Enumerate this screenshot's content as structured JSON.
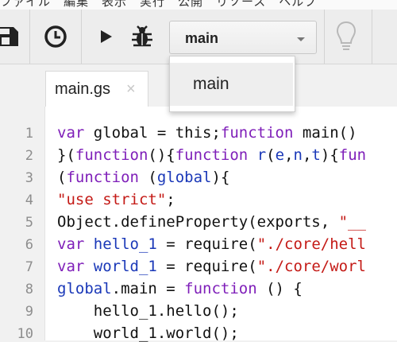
{
  "toolbar": {
    "icons": [
      "save-icon",
      "clock-trigger-icon",
      "run-icon",
      "debug-bug-icon",
      "lightbulb-icon"
    ],
    "function_select": {
      "value": "main"
    }
  },
  "dropdown": {
    "options": [
      "main"
    ]
  },
  "tabs": [
    {
      "label": "main.gs",
      "close": "×"
    }
  ],
  "editor": {
    "line_numbers": [
      "1",
      "2",
      "3",
      "4",
      "5",
      "6",
      "7",
      "8",
      "9",
      "10"
    ],
    "lines": [
      [
        [
          "k",
          "var"
        ],
        [
          "t",
          " global = this;"
        ],
        [
          "k",
          "function"
        ],
        [
          "t",
          " main() "
        ]
      ],
      [
        [
          "t",
          "}("
        ],
        [
          "k",
          "function"
        ],
        [
          "t",
          "(){"
        ],
        [
          "k",
          "function"
        ],
        [
          "t",
          " "
        ],
        [
          "v",
          "r"
        ],
        [
          "t",
          "("
        ],
        [
          "v",
          "e"
        ],
        [
          "t",
          ","
        ],
        [
          "v",
          "n"
        ],
        [
          "t",
          ","
        ],
        [
          "v",
          "t"
        ],
        [
          "t",
          "){"
        ],
        [
          "k",
          "fun"
        ]
      ],
      [
        [
          "t",
          "("
        ],
        [
          "k",
          "function"
        ],
        [
          "t",
          " ("
        ],
        [
          "v",
          "global"
        ],
        [
          "t",
          "){"
        ]
      ],
      [
        [
          "s",
          "\"use strict\""
        ],
        [
          "t",
          ";"
        ]
      ],
      [
        [
          "t",
          "Object.defineProperty(exports, "
        ],
        [
          "s",
          "\"__"
        ]
      ],
      [
        [
          "k",
          "var"
        ],
        [
          "t",
          " "
        ],
        [
          "v",
          "hello_1"
        ],
        [
          "t",
          " = require("
        ],
        [
          "s",
          "\"./core/hell"
        ]
      ],
      [
        [
          "k",
          "var"
        ],
        [
          "t",
          " "
        ],
        [
          "v",
          "world_1"
        ],
        [
          "t",
          " = require("
        ],
        [
          "s",
          "\"./core/worl"
        ]
      ],
      [
        [
          "v",
          "global"
        ],
        [
          "t",
          ".main = "
        ],
        [
          "k",
          "function"
        ],
        [
          "t",
          " () {"
        ]
      ],
      [
        [
          "t",
          "    hello_1.hello();"
        ]
      ],
      [
        [
          "t",
          "    world_1.world();"
        ]
      ]
    ]
  }
}
